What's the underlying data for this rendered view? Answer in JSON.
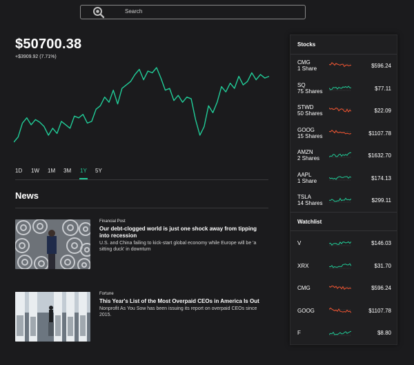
{
  "search": {
    "placeholder": "Search",
    "icon": "search-icon"
  },
  "portfolio": {
    "value": "$50700.38",
    "change": "+$3909.92 (7.71%)"
  },
  "chart_data": {
    "type": "line",
    "x": [
      0,
      1,
      2,
      3,
      4,
      5,
      6,
      7,
      8,
      9,
      10,
      11,
      12,
      13,
      14,
      15,
      16,
      17,
      18,
      19,
      20,
      21,
      22,
      23,
      24,
      25,
      26,
      27,
      28,
      29,
      30,
      31,
      32,
      33,
      34,
      35,
      36,
      37,
      38,
      39,
      40,
      41,
      42,
      43,
      44,
      45,
      46,
      47,
      48,
      49,
      50,
      51,
      52,
      53,
      54,
      55,
      56,
      57,
      58,
      59
    ],
    "values": [
      46500,
      46800,
      47600,
      47900,
      47500,
      47800,
      47650,
      47400,
      46900,
      47300,
      47000,
      47700,
      47500,
      47300,
      48000,
      47900,
      48100,
      47600,
      47700,
      48400,
      48600,
      49100,
      48800,
      49500,
      48700,
      49600,
      49800,
      50000,
      50400,
      50700,
      50100,
      50600,
      50500,
      50800,
      50200,
      49500,
      49600,
      48900,
      49200,
      48800,
      49100,
      49000,
      47800,
      46900,
      47400,
      48600,
      48200,
      48800,
      49700,
      49400,
      49900,
      49600,
      50300,
      49800,
      50000,
      50500,
      50100,
      50400,
      50200,
      50300
    ],
    "color": "#21ce99"
  },
  "ranges": {
    "items": [
      "1D",
      "1W",
      "1M",
      "3M",
      "1Y",
      "5Y"
    ],
    "active": "1Y"
  },
  "news": {
    "title": "News",
    "items": [
      {
        "source": "Financial Post",
        "headline": "Our debt-clogged world is just one shock away from tipping into recession",
        "summary": "U.S. and China failing to kick-start global economy while Europe will be 'a sitting duck' in downturn"
      },
      {
        "source": "Fortune",
        "headline": "This Year's List of the Most Overpaid CEOs in America Is Out",
        "summary": "Nonprofit As You Sow has been issuing its report on overpaid CEOs since 2015."
      }
    ]
  },
  "stocks": {
    "title": "Stocks",
    "items": [
      {
        "symbol": "CMG",
        "shares": "1 Share",
        "price": "$596.24",
        "trend": "down"
      },
      {
        "symbol": "SQ",
        "shares": "75 Shares",
        "price": "$77.11",
        "trend": "up"
      },
      {
        "symbol": "STWD",
        "shares": "50 Shares",
        "price": "$22.09",
        "trend": "down"
      },
      {
        "symbol": "GOOG",
        "shares": "15 Shares",
        "price": "$1107.78",
        "trend": "down"
      },
      {
        "symbol": "AMZN",
        "shares": "2 Shares",
        "price": "$1632.70",
        "trend": "up"
      },
      {
        "symbol": "AAPL",
        "shares": "1 Share",
        "price": "$174.13",
        "trend": "up"
      },
      {
        "symbol": "TSLA",
        "shares": "14 Shares",
        "price": "$299.11",
        "trend": "up"
      }
    ]
  },
  "watchlist": {
    "title": "Watchlist",
    "items": [
      {
        "symbol": "V",
        "price": "$146.03",
        "trend": "up"
      },
      {
        "symbol": "XRX",
        "price": "$31.70",
        "trend": "up"
      },
      {
        "symbol": "CMG",
        "price": "$596.24",
        "trend": "down"
      },
      {
        "symbol": "GOOG",
        "price": "$1107.78",
        "trend": "down"
      },
      {
        "symbol": "F",
        "price": "$8.80",
        "trend": "up"
      }
    ]
  },
  "colors": {
    "up": "#21ce99",
    "down": "#f45531",
    "background": "#1b1b1d"
  }
}
